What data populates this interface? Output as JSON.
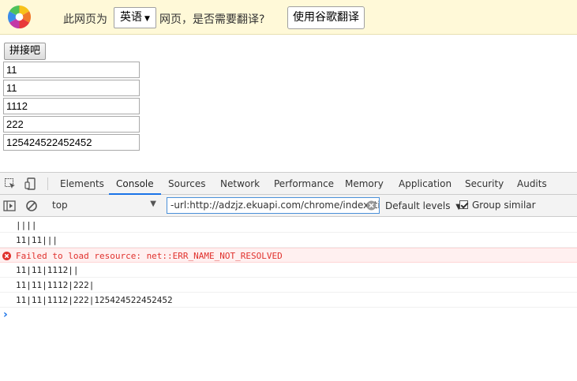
{
  "translate_bar": {
    "prompt_before": "此网页为",
    "language": "英语",
    "prompt_after": "网页，是否需要翻译?",
    "translate_button": "使用谷歌翻译"
  },
  "page": {
    "join_button": "拼接吧",
    "inputs": [
      "11",
      "11",
      "1112",
      "222",
      "125424522452452"
    ]
  },
  "devtools": {
    "tabs": [
      "Elements",
      "Console",
      "Sources",
      "Network",
      "Performance",
      "Memory",
      "Application",
      "Security",
      "Audits"
    ],
    "active_tab": "Console",
    "context": "top",
    "filter_value": "-url:http://adzjz.ekuapi.com/chrome/index?title",
    "levels": "Default levels",
    "group_similar": "Group similar",
    "logs": [
      {
        "text": "||||",
        "type": "log"
      },
      {
        "text": "11|11|||",
        "type": "log"
      },
      {
        "text": "Failed to load resource: net::ERR_NAME_NOT_RESOLVED",
        "type": "error"
      },
      {
        "text": "11|11|1112||",
        "type": "log"
      },
      {
        "text": "11|11|1112|222|",
        "type": "log"
      },
      {
        "text": "11|11|1112|222|125424522452452",
        "type": "log"
      }
    ],
    "prompt": "›",
    "accent_color": "#1a73e8",
    "error_color": "#e0312d"
  }
}
